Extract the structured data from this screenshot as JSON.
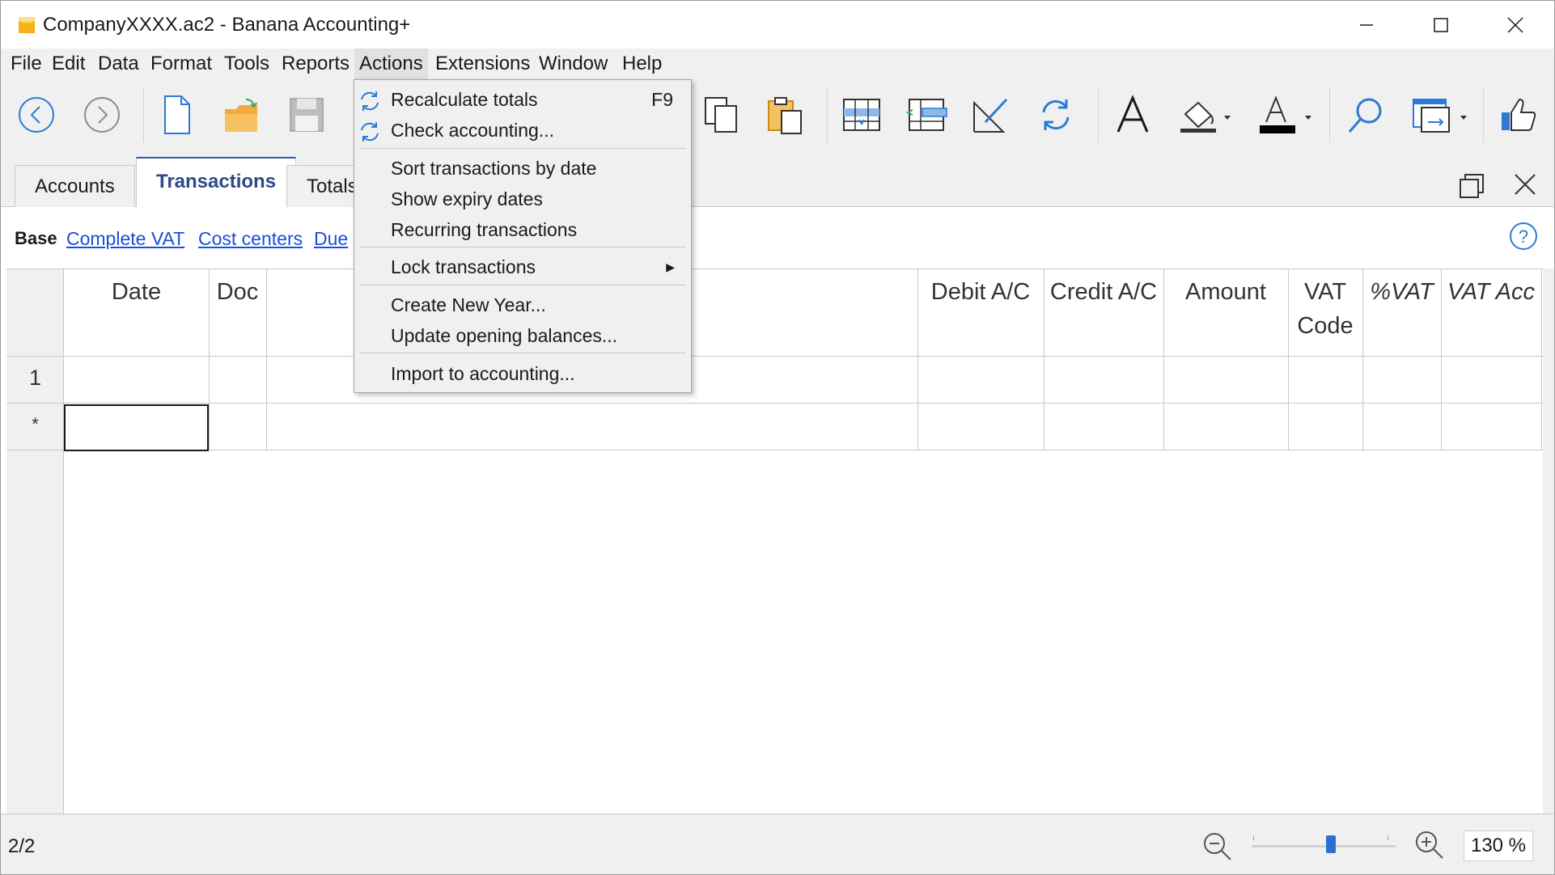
{
  "window": {
    "title": "CompanyXXXX.ac2 - Banana Accounting+"
  },
  "menubar": {
    "items": [
      "File",
      "Edit",
      "Data",
      "Format",
      "Tools",
      "Reports",
      "Actions",
      "Extensions",
      "Window",
      "Help"
    ],
    "active": "Actions"
  },
  "actions_menu": {
    "items": [
      {
        "label": "Recalculate totals",
        "shortcut": "F9",
        "icon": "refresh-icon"
      },
      {
        "label": "Check accounting...",
        "icon": "refresh-icon"
      },
      {
        "label": "Sort transactions by date"
      },
      {
        "label": "Show expiry dates"
      },
      {
        "label": "Recurring transactions"
      },
      {
        "label": "Lock transactions",
        "submenu": true
      },
      {
        "label": "Create New Year..."
      },
      {
        "label": "Update opening balances..."
      },
      {
        "label": "Import to accounting..."
      }
    ]
  },
  "tabs": [
    "Accounts",
    "Transactions",
    "Totals"
  ],
  "active_tab": "Transactions",
  "views": {
    "base": "Base",
    "links": [
      "Complete VAT",
      "Cost centers",
      "Due"
    ]
  },
  "table": {
    "columns": [
      "Date",
      "Doc",
      "Debit A/C",
      "Credit A/C",
      "Amount",
      "VAT Code",
      "%VAT",
      "VAT Acc"
    ],
    "vat_code_line1": "VAT",
    "vat_code_line2": "Code",
    "rows": [
      {
        "num": "1"
      },
      {
        "num": "*"
      }
    ]
  },
  "status": {
    "position": "2/2",
    "zoom": "130 %",
    "zoom_level": 0.5
  },
  "colors": {
    "accent": "#2b5faa",
    "link": "#1a4fd6",
    "icon_blue": "#2b7bd6",
    "folder": "#f3a93b"
  }
}
